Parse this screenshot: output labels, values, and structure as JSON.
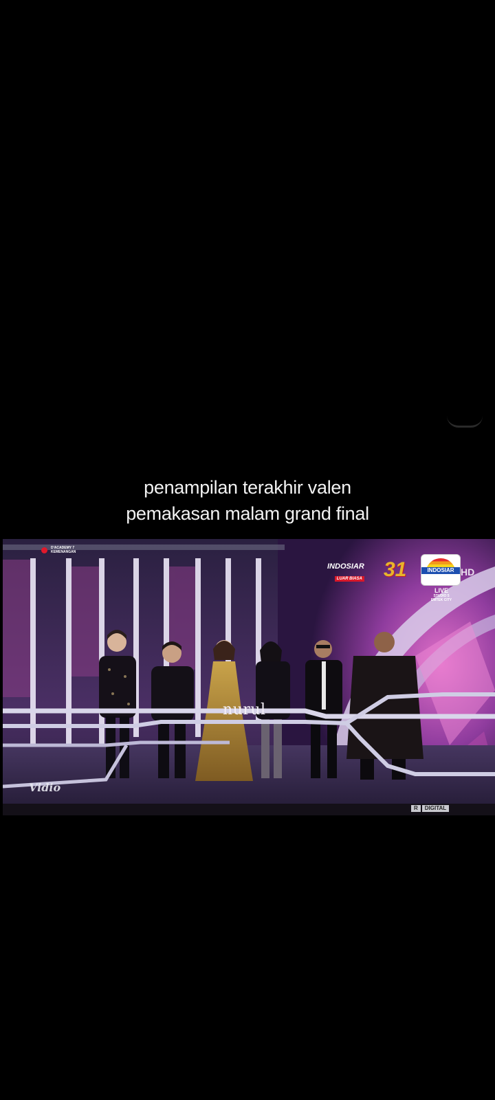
{
  "caption": {
    "line1": "penampilan terakhir valen",
    "line2": "pemakasan malam grand final"
  },
  "video": {
    "watermark": "nurul",
    "vidio_logo": "Vidio",
    "show_logo": {
      "line1": "D'ACADEMY 7",
      "line2": "KEMENANGAN"
    },
    "channel": {
      "indosiar": "INDOSIAR",
      "tagline": "LUAR BIASA",
      "anniversary": "31",
      "logo_text": "INDOSIAR",
      "hd": "HD",
      "live": "LIVE",
      "studio_line1": "STUDIO 5",
      "studio_line2": "EMTEK CITY"
    },
    "rating": "R",
    "digital": "DIGITAL"
  },
  "colors": {
    "background": "#000000",
    "caption_text": "#f2f2f2",
    "stage_purple": "#3a2657",
    "accent_red": "#d8182a",
    "accent_gold": "#e7b52b"
  }
}
